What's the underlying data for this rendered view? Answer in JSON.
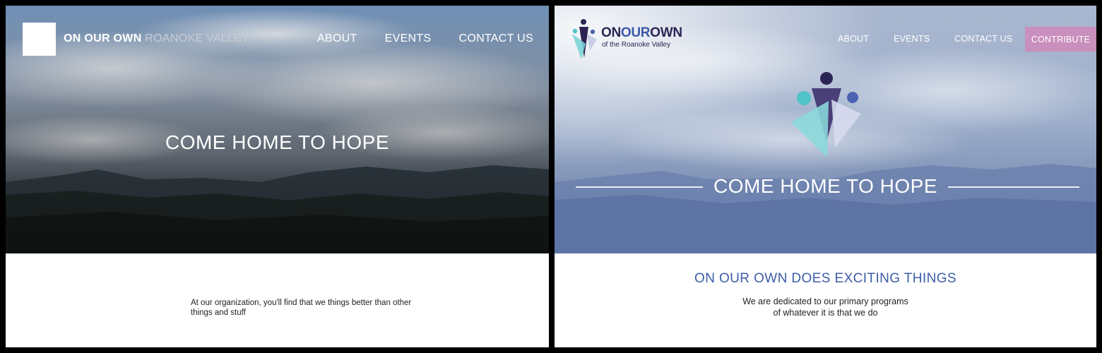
{
  "left_panel": {
    "brand": {
      "primary": "ON OUR OWN",
      "secondary": "ROANOKE VALLEY"
    },
    "nav": [
      "ABOUT",
      "EVENTS",
      "CONTACT US"
    ],
    "hero_title": "COME HOME TO HOPE",
    "body_text": "At our organization, you'll find that we things better than other things and stuff"
  },
  "right_panel": {
    "brand": {
      "part1": "ON",
      "part2": "OUR",
      "part3": "OWN",
      "subtitle": "of the Roanoke Valley"
    },
    "nav": [
      "ABOUT",
      "EVENTS",
      "CONTACT US"
    ],
    "cta_label": "CONTRIBUTE",
    "hero_title": "COME HOME TO HOPE",
    "section_title": "ON OUR OWN DOES EXCITING THINGS",
    "section_lines": [
      "We are dedicated to our primary programs",
      "of whatever it is that we do"
    ]
  },
  "colors": {
    "brand_navy": "#2b2553",
    "brand_blue": "#3b59a8",
    "brand_teal": "#4fc3c9",
    "cta_pink": "#c98fbd",
    "heading_blue": "#3c5da8"
  }
}
